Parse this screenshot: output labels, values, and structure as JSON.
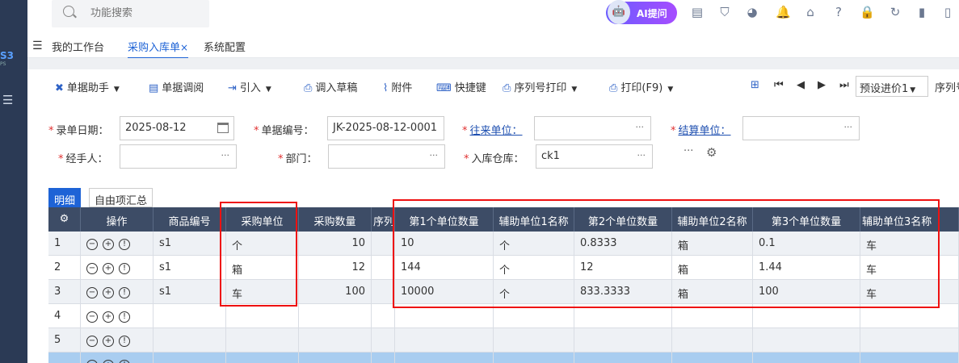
{
  "sidebar": {
    "logo": "S3",
    "logo_sub": "PS",
    "menu_icon": "collapse-menu-icon"
  },
  "search": {
    "placeholder": "功能搜索"
  },
  "ai": {
    "label": "AI提问"
  },
  "header_icons": [
    "message-icon",
    "shield-icon",
    "pie-icon",
    "bell-icon",
    "home-icon",
    "help-icon",
    "lock-icon",
    "refresh-icon",
    "book-icon",
    "bookmark-icon",
    "user-icon"
  ],
  "tabs": [
    {
      "label": "我的工作台"
    },
    {
      "label": "采购入库单"
    },
    {
      "label": "系统配置"
    }
  ],
  "toolbar": {
    "helper": "单据助手",
    "lookup": "单据调阅",
    "import": "引入",
    "draft": "调入草稿",
    "attach": "附件",
    "shortcut": "快捷键",
    "serial_print": "序列号打印",
    "print": "打印(F9)",
    "preset": "预设进价1",
    "serial_short": "序列号"
  },
  "form": {
    "date_label": "录单日期：",
    "date_value": "2025-08-12",
    "docno_label": "单据编号：",
    "docno_value": "JK-2025-08-12-0001",
    "partner_label": "往来单位：",
    "partner_value": "",
    "settle_label": "结算单位：",
    "settle_value": "",
    "handler_label": "经手人：",
    "handler_value": "",
    "dept_label": "部门：",
    "dept_value": "",
    "warehouse_label": "入库仓库：",
    "warehouse_value": "ck1"
  },
  "subtabs": [
    {
      "label": "明细"
    },
    {
      "label": "自由项汇总"
    }
  ],
  "table": {
    "headers": [
      "操作",
      "商品编号",
      "采购单位",
      "采购数量",
      "序列",
      "第1个单位数量",
      "辅助单位1名称",
      "第2个单位数量",
      "辅助单位2名称",
      "第3个单位数量",
      "辅助单位3名称"
    ],
    "rows": [
      {
        "no": "1",
        "code": "s1",
        "unit": "个",
        "qty": "10",
        "u1": "10",
        "n1": "个",
        "u2": "0.8333",
        "n2": "箱",
        "u3": "0.1",
        "n3": "车"
      },
      {
        "no": "2",
        "code": "s1",
        "unit": "箱",
        "qty": "12",
        "u1": "144",
        "n1": "个",
        "u2": "12",
        "n2": "箱",
        "u3": "1.44",
        "n3": "车"
      },
      {
        "no": "3",
        "code": "s1",
        "unit": "车",
        "qty": "100",
        "u1": "10000",
        "n1": "个",
        "u2": "833.3333",
        "n2": "箱",
        "u3": "100",
        "n3": "车"
      },
      {
        "no": "4",
        "code": "",
        "unit": "",
        "qty": "",
        "u1": "",
        "n1": "",
        "u2": "",
        "n2": "",
        "u3": "",
        "n3": ""
      },
      {
        "no": "5",
        "code": "",
        "unit": "",
        "qty": "",
        "u1": "",
        "n1": "",
        "u2": "",
        "n2": "",
        "u3": "",
        "n3": ""
      },
      {
        "no": "",
        "code": "",
        "unit": "",
        "qty": "",
        "u1": "",
        "n1": "",
        "u2": "",
        "n2": "",
        "u3": "",
        "n3": ""
      }
    ]
  }
}
